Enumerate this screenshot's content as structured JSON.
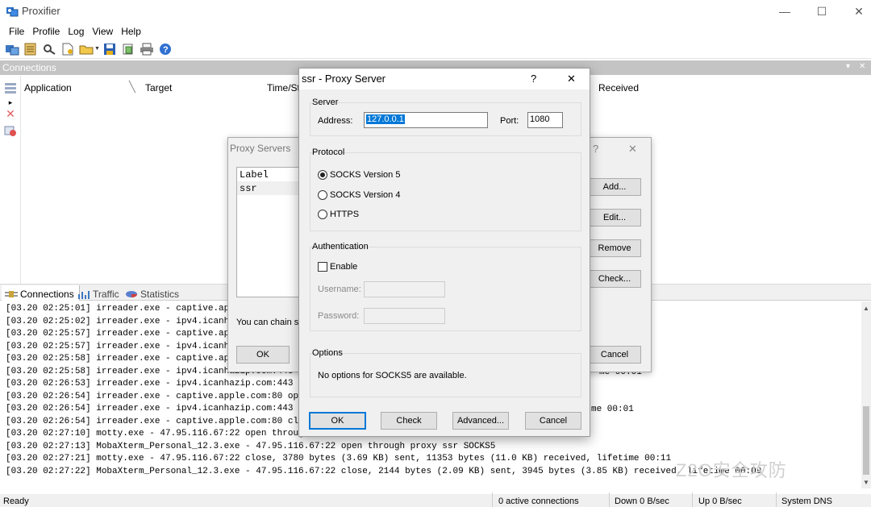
{
  "app": {
    "title": "Proxifier"
  },
  "window_controls": {
    "minimize": "—",
    "maximize": "☐",
    "close": "✕"
  },
  "menu": [
    "File",
    "Profile",
    "Log",
    "View",
    "Help"
  ],
  "toolbar": {
    "icons": [
      "proxy-servers-icon",
      "proxification-rules-icon",
      "name-resolution-icon",
      "new-profile-icon",
      "open-profile-icon",
      "save-profile-icon",
      "advanced-icon",
      "print-icon",
      "help-icon"
    ]
  },
  "connections_panel": {
    "title": "Connections",
    "header_controls": {
      "pin": "▾",
      "close": "✕"
    },
    "columns": [
      "Application",
      "Target",
      "Time/Sta",
      "Received"
    ]
  },
  "tabs": [
    "Connections",
    "Traffic",
    "Statistics"
  ],
  "log": [
    "[03.20 02:25:01] irreader.exe - captive.appl",
    "[03.20 02:25:02] irreader.exe - ipv4.icanhaz",
    "[03.20 02:25:57] irreader.exe - captive.appl",
    "[03.20 02:25:57] irreader.exe - ipv4.icanhaz",
    "[03.20 02:25:58] irreader.exe - captive.appl",
    "[03.20 02:25:58] irreader.exe - ipv4.icanhazip.com:443 clo",
    "[03.20 02:26:53] irreader.exe - ipv4.icanhazip.com:443 ope",
    "[03.20 02:26:54] irreader.exe - captive.apple.com:80 open",
    "[03.20 02:26:54] irreader.exe - ipv4.icanhazip.com:443 clo",
    "[03.20 02:26:54] irreader.exe - captive.apple.com:80 close",
    "[03.20 02:27:10] motty.exe - 47.95.116.67:22 open through",
    "[03.20 02:27:13] MobaXterm_Personal_12.3.exe - 47.95.116.67:22 open through proxy ssr SOCKS5",
    "[03.20 02:27:21] motty.exe - 47.95.116.67:22 close, 3780 bytes (3.69 KB) sent, 11353 bytes (11.0 KB) received, lifetime 00:11",
    "[03.20 02:27:22] MobaXterm_Personal_12.3.exe - 47.95.116.67:22 close, 2144 bytes (2.09 KB) sent, 3945 bytes (3.85 KB) received, lifetime 00:09"
  ],
  "log_right_fragments": [
    "me 00:01",
    "me 00:01"
  ],
  "status": {
    "ready": "Ready",
    "active": "0 active connections",
    "down": "Down 0 B/sec",
    "up": "Up 0 B/sec",
    "dns": "System DNS"
  },
  "proxy_servers_dialog": {
    "title": "Proxy Servers",
    "help": "?",
    "close": "✕",
    "list_header": "Label",
    "list_items": [
      "ssr"
    ],
    "buttons": {
      "add": "Add...",
      "edit": "Edit...",
      "remove": "Remove",
      "check": "Check...",
      "ok": "OK",
      "cancel": "Cancel"
    },
    "chain_text": "You can chain se"
  },
  "proxy_server_dialog": {
    "title": "ssr - Proxy Server",
    "help": "?",
    "close": "✕",
    "server": {
      "label": "Server",
      "address_label": "Address:",
      "address": "127.0.0.1",
      "port_label": "Port:",
      "port": "1080"
    },
    "protocol": {
      "label": "Protocol",
      "options": [
        "SOCKS Version 5",
        "SOCKS Version 4",
        "HTTPS"
      ],
      "selected": "SOCKS Version 5"
    },
    "authentication": {
      "label": "Authentication",
      "enable": "Enable",
      "enabled": false,
      "username_label": "Username:",
      "password_label": "Password:"
    },
    "options": {
      "label": "Options",
      "text": "No options for SOCKS5 are available."
    },
    "buttons": {
      "ok": "OK",
      "check": "Check",
      "advanced": "Advanced...",
      "cancel": "Cancel"
    }
  },
  "watermark": "Z2O安全攻防",
  "colors": {
    "panel_header": "#c4c4c4",
    "selection": "#0078d7"
  }
}
